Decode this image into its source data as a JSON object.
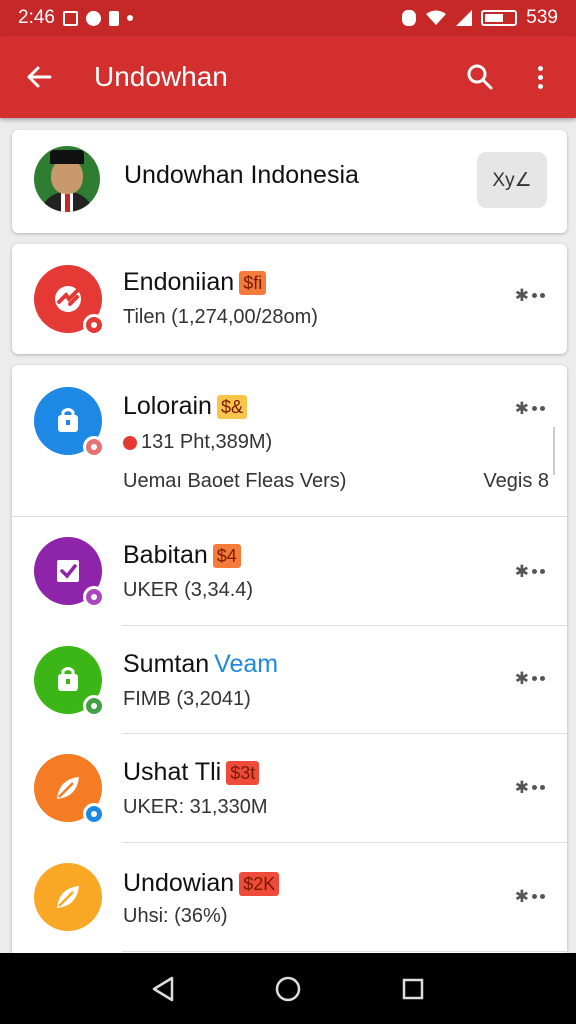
{
  "status_bar": {
    "time": "2:46",
    "battery_text": "539",
    "icons": [
      "gallery-icon",
      "circle-icon",
      "card-icon",
      "dot-icon",
      "alarm-icon",
      "wifi-icon",
      "signal-icon",
      "battery-icon"
    ]
  },
  "app_bar": {
    "title": "Undowhan",
    "back_icon": "arrow-left-icon",
    "search_icon": "search-icon",
    "more_icon": "more-vertical-icon"
  },
  "header": {
    "title": "Undowhan Indonesia",
    "button_label": "Xy∠"
  },
  "items": [
    {
      "name": "Endoniian",
      "badge": "$fi",
      "badge_color": "#f47b3a",
      "subtitle": "Tilen (1,274,00/28om)",
      "icon_color": "#e53935",
      "icon_name": "refresh-icon",
      "mini_badge_color": "#e53935"
    },
    {
      "name": "Lolorain",
      "badge": "$&",
      "badge_color": "#f8c44a",
      "subtitle": "131 Pht,389M)",
      "subtitle_prefix": "(",
      "extra_left": "Uemaı Baoet Fleas Vers)",
      "extra_right": "Vegis 8",
      "icon_color": "#1e88e5",
      "icon_name": "bag-icon",
      "mini_badge_color": "#e57373"
    },
    {
      "name": "Babitan",
      "badge": "$4",
      "badge_color": "#f47b3a",
      "subtitle": "UKER  (3,34.4)",
      "icon_color": "#8e24aa",
      "icon_name": "check-square-icon",
      "mini_badge_color": "#ab47bc"
    },
    {
      "name": "Sumtan",
      "name_suffix": "Veam",
      "subtitle": "FIMB (3,2041)",
      "icon_color": "#3cb517",
      "icon_name": "bag-icon",
      "mini_badge_color": "#43a047"
    },
    {
      "name": "Ushat Tli",
      "badge": "$3t",
      "badge_color": "#ef4b3a",
      "subtitle": "UKER: 31,330M",
      "icon_color": "#f57c25",
      "icon_name": "leaf-icon",
      "mini_badge_color": "#1e88e5"
    },
    {
      "name": "Undowian",
      "badge": "$2K",
      "badge_color": "#ef4b3a",
      "subtitle": "Uhsi: (36%)",
      "icon_color": "#f9a825",
      "icon_name": "leaf-icon"
    }
  ],
  "nav_bar": {
    "back_icon": "nav-back-icon",
    "home_icon": "nav-home-icon",
    "recents_icon": "nav-recents-icon"
  }
}
